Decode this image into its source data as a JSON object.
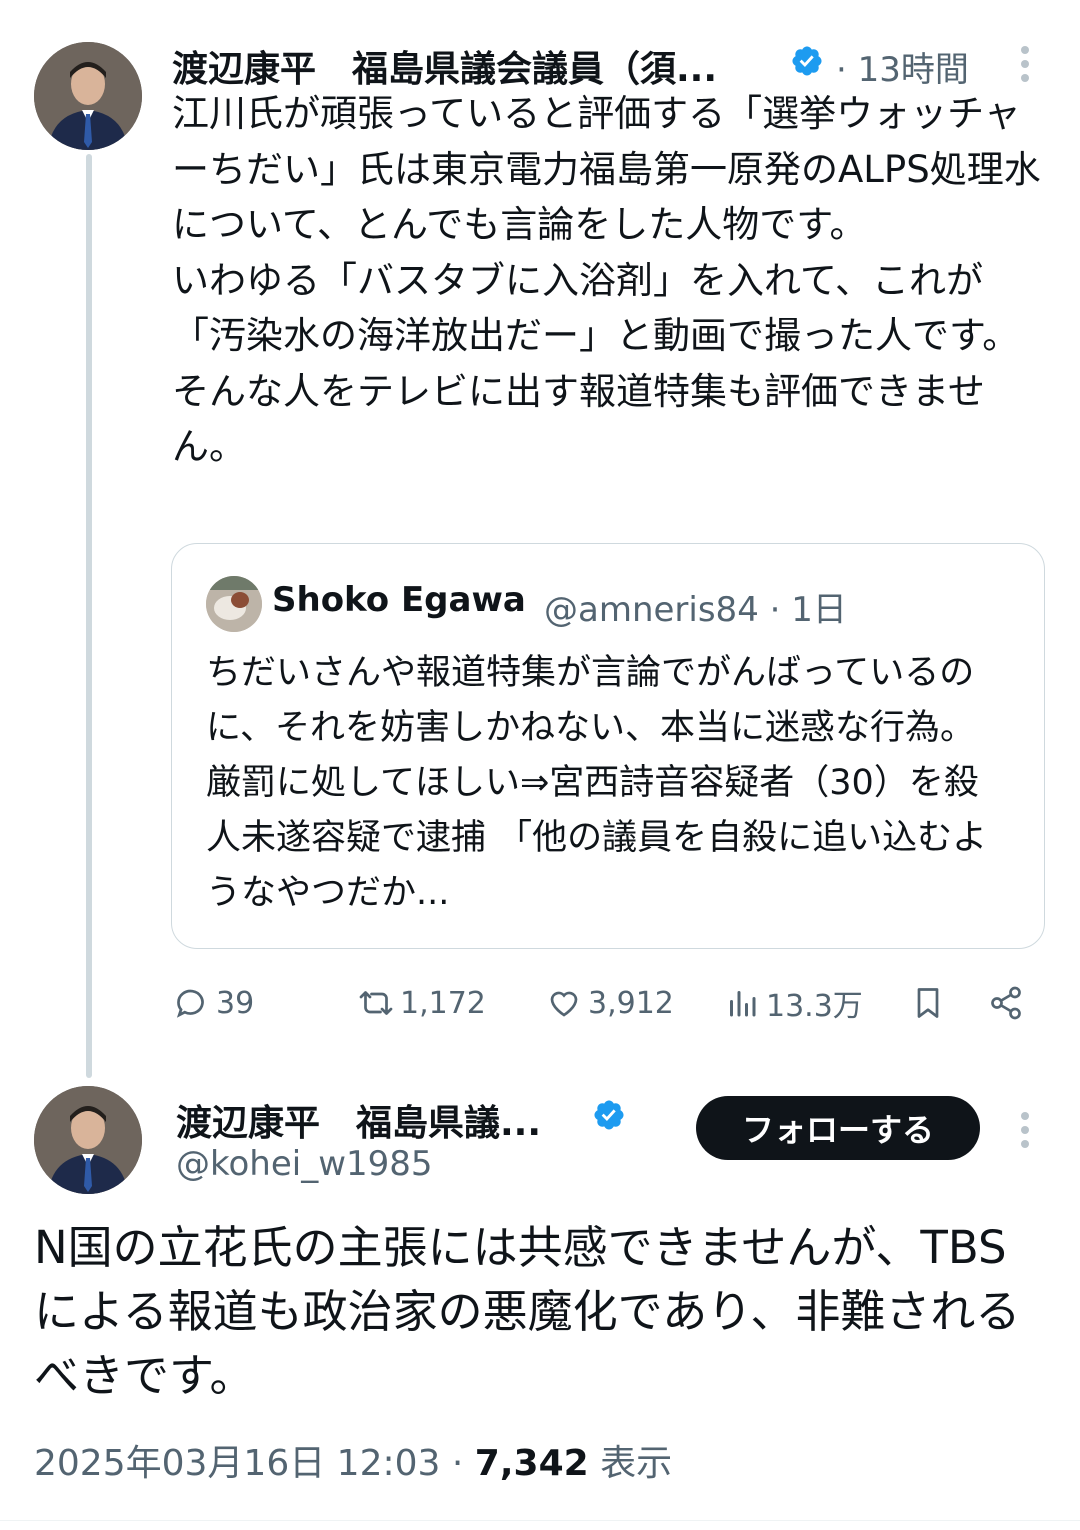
{
  "tweet1": {
    "author": "渡辺康平　福島県議会議員（須...",
    "time": "13時間",
    "separator": "·",
    "text": "江川氏が頑張っていると評価する「選挙ウォッチャーちだい」氏は東京電力福島第一原発のALPS処理水について、とんでも言論をした人物です。\nいわゆる「バスタブに入浴剤」を入れて、これが「汚染水の海洋放出だー」と動画で撮った人です。そんな人をテレビに出す報道特集も評価できません。",
    "quote": {
      "author": "Shoko Egawa",
      "handle": "@amneris84",
      "time": "1日",
      "text": "ちだいさんや報道特集が言論でがんばっているのに、それを妨害しかねない、本当に迷惑な行為。厳罰に処してほしい⇒宮西詩音容疑者（30）を殺人未遂容疑で逮捕 「他の議員を自殺に追い込むようなやつだか..."
    },
    "actions": {
      "replies": "39",
      "reposts": "1,172",
      "likes": "3,912",
      "views": "13.3万"
    }
  },
  "tweet2": {
    "author": "渡辺康平　福島県議...",
    "handle": "@kohei_w1985",
    "follow_label": "フォローする",
    "text": "N国の立花氏の主張には共感できませんが、TBSによる報道も政治家の悪魔化であり、非難されるべきです。",
    "timestamp": "2025年03月16日 12:03",
    "separator": "·",
    "views_count": "7,342",
    "views_label": "表示"
  },
  "colors": {
    "verified": "#1d9bf0",
    "secondary_text": "#536471",
    "primary_text": "#0f1419",
    "border": "#cfd9de"
  }
}
